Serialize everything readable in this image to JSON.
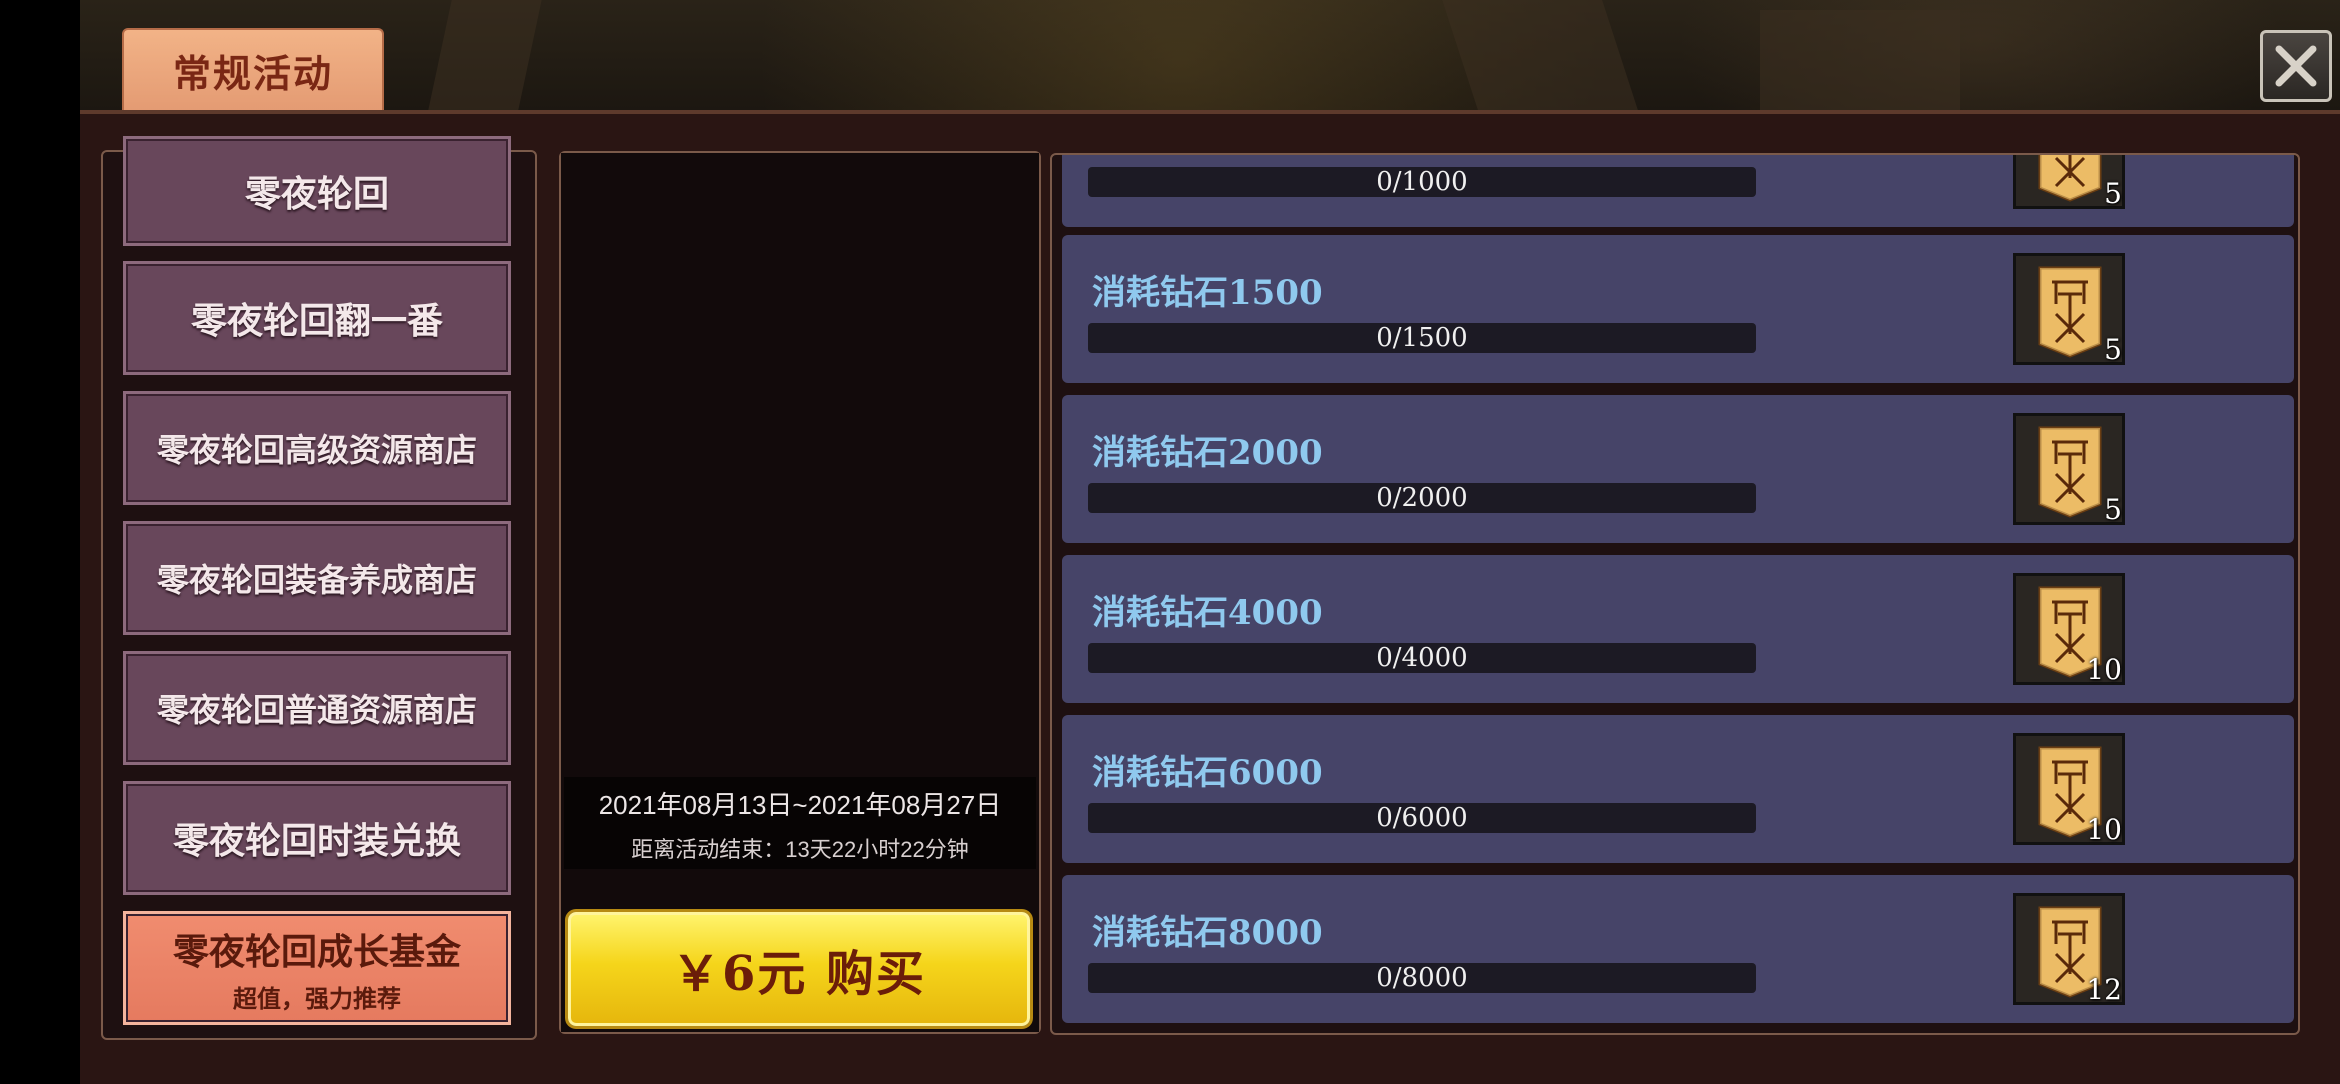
{
  "header": {
    "tab_label": "常规活动"
  },
  "sidebar": {
    "items": [
      {
        "label": "零夜轮回",
        "sub": ""
      },
      {
        "label": "零夜轮回翻一番",
        "sub": ""
      },
      {
        "label": "零夜轮回高级资源商店",
        "sub": ""
      },
      {
        "label": "零夜轮回装备养成商店",
        "sub": ""
      },
      {
        "label": "零夜轮回普通资源商店",
        "sub": ""
      },
      {
        "label": "零夜轮回时装兑换",
        "sub": ""
      },
      {
        "label": "零夜轮回成长基金",
        "sub": "超值，强力推荐",
        "active": true
      }
    ]
  },
  "event": {
    "date_range": "2021年08月13日~2021年08月27日",
    "countdown": "距离活动结束：13天22小时22分钟",
    "buy_label": "￥6元  购买"
  },
  "tasks": [
    {
      "title": "",
      "progress_text": "0/1000",
      "progress": 0,
      "reward_count": "5"
    },
    {
      "title": "消耗钻石1500",
      "progress_text": "0/1500",
      "progress": 0,
      "reward_count": "5"
    },
    {
      "title": "消耗钻石2000",
      "progress_text": "0/2000",
      "progress": 0,
      "reward_count": "5"
    },
    {
      "title": "消耗钻石4000",
      "progress_text": "0/4000",
      "progress": 0,
      "reward_count": "10"
    },
    {
      "title": "消耗钻石6000",
      "progress_text": "0/6000",
      "progress": 0,
      "reward_count": "10"
    },
    {
      "title": "消耗钻石8000",
      "progress_text": "0/8000",
      "progress": 0,
      "reward_count": "12"
    }
  ],
  "icons": {
    "close": "close-icon",
    "reward": "banner-scroll-icon"
  },
  "colors": {
    "tab_accent": "#e49b73",
    "active_nav": "#e57a5f",
    "task_title": "#8fc9ee",
    "buy_button": "#f5d51b"
  }
}
